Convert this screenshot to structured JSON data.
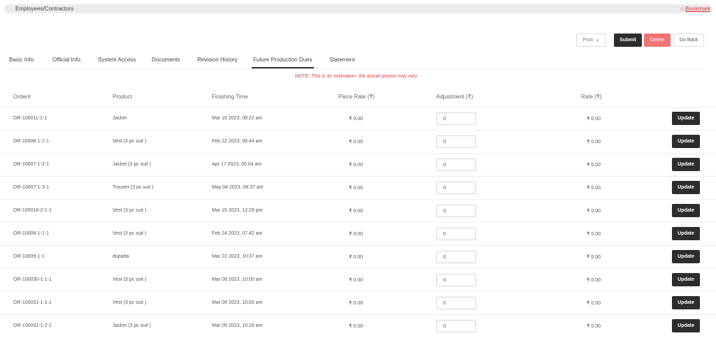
{
  "breadcrumb": "Employees/Contractors",
  "bookmark": {
    "star": "☆",
    "label": "Bookmark"
  },
  "actions": {
    "print": "Print",
    "print_chevron": "∨",
    "submit": "Submit",
    "delete": "Delete",
    "go_back": "Go Back"
  },
  "tabs": [
    {
      "label": "Basic Info."
    },
    {
      "label": "Official Info."
    },
    {
      "label": "System Access"
    },
    {
      "label": "Documents"
    },
    {
      "label": "Revision History"
    },
    {
      "label": "Future Production Dues",
      "active": true
    },
    {
      "label": "Statement"
    }
  ],
  "note": "NOTE: This is an estimation, the actual payout may vary.",
  "table": {
    "columns": [
      "Order#",
      "Product",
      "Finishing Time",
      "Piece Rate (₹)",
      "Adjustment (₹)",
      "Rate (₹)"
    ],
    "update_label": "Update",
    "rows": [
      {
        "order": "OR-100011-1-1",
        "product": "Jacket",
        "finishing_time": "Mar 15 2023, 06:22 am",
        "piece_rate": "₹ 0.00",
        "adjustment": "0",
        "rate": "₹ 0.00"
      },
      {
        "order": "OR-10008-1-1-1",
        "product": "Vest (3 pc suit )",
        "finishing_time": "Feb 22 2023, 06:44 am",
        "piece_rate": "₹ 0.00",
        "adjustment": "0",
        "rate": "₹ 0.00"
      },
      {
        "order": "OR-10007-1-2-1",
        "product": "Jacket (3 pc suit )",
        "finishing_time": "Apr 17 2023, 05:04 am",
        "piece_rate": "₹ 0.00",
        "adjustment": "0",
        "rate": "₹ 0.00"
      },
      {
        "order": "OR-10007-1-3-1",
        "product": "Trouser (3 pc suit )",
        "finishing_time": "May 04 2023, 08:37 am",
        "piece_rate": "₹ 0.00",
        "adjustment": "0",
        "rate": "₹ 0.00"
      },
      {
        "order": "OR-100018-2-1-1",
        "product": "Vest (3 pc suit )",
        "finishing_time": "Mar 15 2023, 12:29 pm",
        "piece_rate": "₹ 0.00",
        "adjustment": "0",
        "rate": "₹ 0.00"
      },
      {
        "order": "OR-10008-1-1-1",
        "product": "Vest (3 pc suit )",
        "finishing_time": "Feb 24 2023, 07:42 am",
        "piece_rate": "₹ 0.00",
        "adjustment": "0",
        "rate": "₹ 0.00"
      },
      {
        "order": "OR-10009-1-1",
        "product": "dupatta",
        "finishing_time": "Mar 22 2023, 10:37 am",
        "piece_rate": "₹ 0.00",
        "adjustment": "0",
        "rate": "₹ 0.00"
      },
      {
        "order": "OR-100030-1-1-1",
        "product": "Vest (3 pc suit )",
        "finishing_time": "Mar 09 2023, 10:00 am",
        "piece_rate": "₹ 0.00",
        "adjustment": "0",
        "rate": "₹ 0.00"
      },
      {
        "order": "OR-100031-1-1-1",
        "product": "Vest (3 pc suit )",
        "finishing_time": "Mar 09 2023, 10:05 am",
        "piece_rate": "₹ 0.00",
        "adjustment": "0",
        "rate": "₹ 0.00"
      },
      {
        "order": "OR-100031-1-2-1",
        "product": "Jacket (3 pc suit )",
        "finishing_time": "Mar 09 2023, 10:16 am",
        "piece_rate": "₹ 0.00",
        "adjustment": "0",
        "rate": "₹ 0.00"
      }
    ]
  },
  "colors": {
    "accent_dark": "#2d2d2d",
    "delete": "#f07474",
    "note": "#e03b3b",
    "bookmark": "#d9323a"
  }
}
